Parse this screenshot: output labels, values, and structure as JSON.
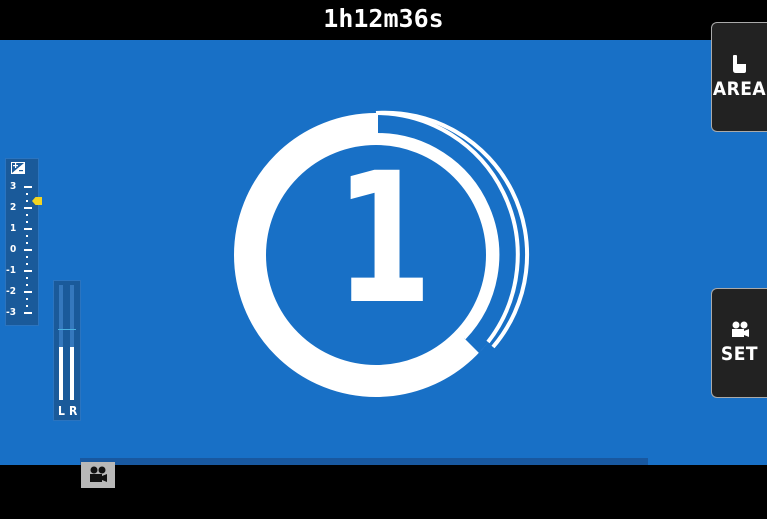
{
  "status": {
    "remaining_time": "1h12m36s"
  },
  "countdown": {
    "number": "1",
    "progress_fraction": 0.62
  },
  "side_buttons": {
    "area": {
      "icon": "touch-icon",
      "label": "AREA"
    },
    "set": {
      "icon": "movie-camera-icon",
      "label": "SET"
    }
  },
  "exposure": {
    "scale_labels": [
      "3",
      "2",
      "1",
      "0",
      "-1",
      "-2",
      "-3"
    ],
    "icon": "exposure-compensation-icon",
    "current_value": 2
  },
  "audio": {
    "channel_left": "L",
    "channel_right": "R",
    "level_left": 0.48,
    "level_right": 0.48
  },
  "mode": {
    "icon": "movie-camera-icon"
  },
  "colors": {
    "screen_bg": "#1870c6",
    "accent_yellow": "#f2d422"
  }
}
